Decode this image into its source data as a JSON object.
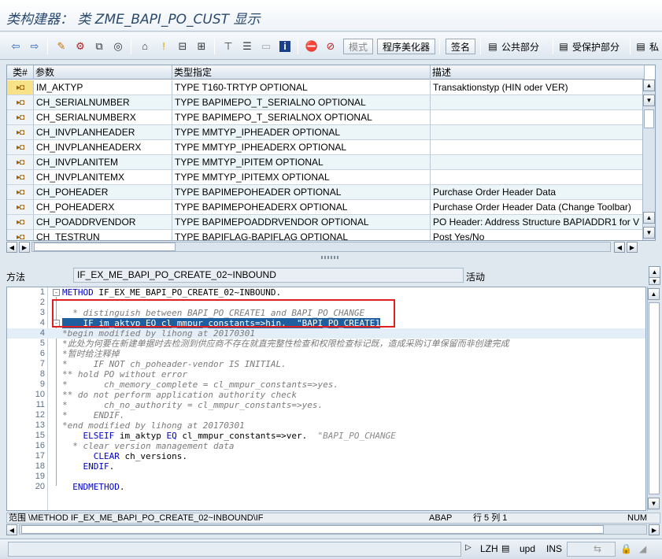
{
  "window": {
    "title": "类构建器： 类 ZME_BAPI_PO_CUST 显示"
  },
  "toolbar": {
    "mode_label": "模式",
    "pretty_printer_label": "程序美化器",
    "signature_label": "签名",
    "public_section_label": "公共部分",
    "protected_section_label": "受保护部分",
    "private_section_label": "私"
  },
  "params": {
    "headers": [
      "类#",
      "参数",
      "类型指定",
      "描述"
    ],
    "rows": [
      {
        "name": "IM_AKTYP",
        "type": "TYPE T160-TRTYP OPTIONAL",
        "desc": "Transaktionstyp (HIN oder VER)"
      },
      {
        "name": "CH_SERIALNUMBER",
        "type": "TYPE BAPIMEPO_T_SERIALNO OPTIONAL",
        "desc": ""
      },
      {
        "name": "CH_SERIALNUMBERX",
        "type": "TYPE BAPIMEPO_T_SERIALNOX OPTIONAL",
        "desc": ""
      },
      {
        "name": "CH_INVPLANHEADER",
        "type": "TYPE MMTYP_IPHEADER OPTIONAL",
        "desc": ""
      },
      {
        "name": "CH_INVPLANHEADERX",
        "type": "TYPE MMTYP_IPHEADERX OPTIONAL",
        "desc": ""
      },
      {
        "name": "CH_INVPLANITEM",
        "type": "TYPE MMTYP_IPITEM OPTIONAL",
        "desc": ""
      },
      {
        "name": "CH_INVPLANITEMX",
        "type": "TYPE MMTYP_IPITEMX OPTIONAL",
        "desc": ""
      },
      {
        "name": "CH_POHEADER",
        "type": "TYPE BAPIMEPOHEADER OPTIONAL",
        "desc": "Purchase Order Header Data"
      },
      {
        "name": "CH_POHEADERX",
        "type": "TYPE BAPIMEPOHEADERX OPTIONAL",
        "desc": "Purchase Order Header Data (Change Toolbar)"
      },
      {
        "name": "CH_POADDRVENDOR",
        "type": "TYPE BAPIMEPOADDRVENDOR OPTIONAL",
        "desc": "PO Header: Address Structure BAPIADDR1 for V"
      },
      {
        "name": "CH_TESTRUN",
        "type": "TYPE BAPIFLAG-BAPIFLAG OPTIONAL",
        "desc": "Post Yes/No"
      }
    ]
  },
  "method": {
    "label": "方法",
    "name": "IF_EX_ME_BAPI_PO_CREATE_02~INBOUND",
    "status": "活动"
  },
  "code": {
    "lines": [
      {
        "n": "1",
        "code": "METHOD IF_EX_ME_BAPI_PO_CREATE_02~INBOUND."
      },
      {
        "n": "2",
        "code": ""
      },
      {
        "n": "3",
        "code": "  * distinguish between BAPI_PO_CREATE1 and BAPI_PO_CHANGE"
      },
      {
        "n": "4",
        "code": "    IF im_aktyp EQ cl_mmpur_constants=>hin.  \"BAPI_PO_CREATE1"
      },
      {
        "n": "4",
        "code": "*begin modified by lihong at 20170301"
      },
      {
        "n": "5",
        "code": "*此处为何要在新建单据时去检测到供应商不存在就直完整性检查和权限检查标记既，造成采购订单保留而非创建完成"
      },
      {
        "n": "6",
        "code": "*暂时给注释掉"
      },
      {
        "n": "7",
        "code": "*     IF NOT ch_poheader-vendor IS INITIAL."
      },
      {
        "n": "8",
        "code": "** hold PO without error"
      },
      {
        "n": "9",
        "code": "*       ch_memory_complete = cl_mmpur_constants=>yes."
      },
      {
        "n": "10",
        "code": "** do not perform application authority check"
      },
      {
        "n": "11",
        "code": "*       ch_no_authority = cl_mmpur_constants=>yes."
      },
      {
        "n": "12",
        "code": "*     ENDIF."
      },
      {
        "n": "13",
        "code": "*end modified by lihong at 20170301"
      },
      {
        "n": "15",
        "code": "    ELSEIF im_aktyp EQ cl_mmpur_constants=>ver.  \"BAPI_PO_CHANGE"
      },
      {
        "n": "16",
        "code": "  * clear version management data"
      },
      {
        "n": "17",
        "code": "      CLEAR ch_versions."
      },
      {
        "n": "18",
        "code": "    ENDIF."
      },
      {
        "n": "19",
        "code": ""
      },
      {
        "n": "20",
        "code": "  ENDMETHOD."
      }
    ]
  },
  "editor_status": {
    "scope": "范围 \\METHOD IF_EX_ME_BAPI_PO_CREATE_02~INBOUND\\IF",
    "language": "ABAP",
    "position": "行   5 列   1",
    "mode": "NUM"
  },
  "statusbar": {
    "system": "LZH",
    "server": "upd",
    "insert_mode": "INS"
  }
}
